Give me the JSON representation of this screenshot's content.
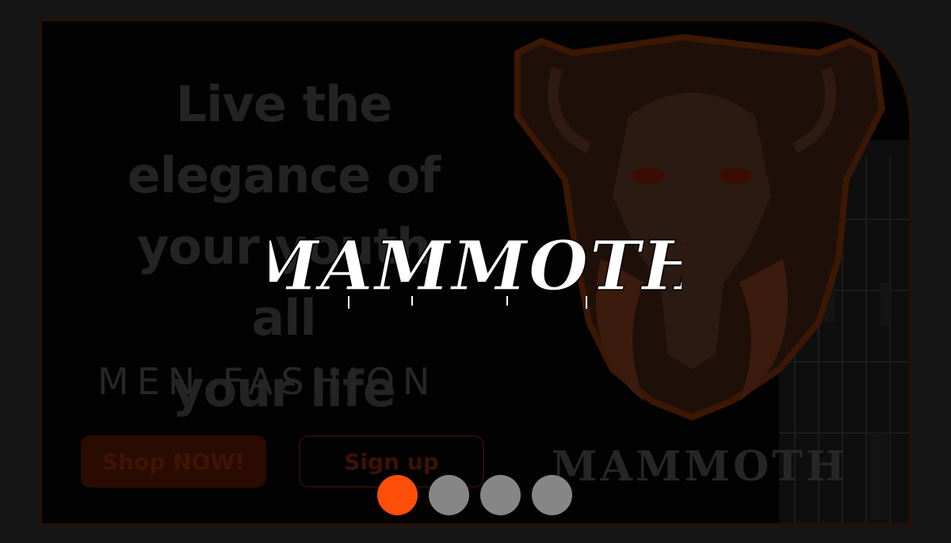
{
  "hero": {
    "headline_lines": [
      "Live the",
      "elegance of",
      "your youth all",
      "your life"
    ],
    "subtitle": "MEN FASHION",
    "shop_button": "Shop NOW!",
    "signup_button": "Sign up"
  },
  "brand": {
    "logo_text": "MAMMOTH",
    "overlay_logo_text": "MAMMOTH"
  },
  "carousel": {
    "slide_count": 4,
    "active_index": 0
  },
  "colors": {
    "accent": "#ff4d0a",
    "dot_inactive": "#868686",
    "background": "#161616"
  },
  "icons": {
    "mascot": "mammoth-mascot-icon"
  }
}
